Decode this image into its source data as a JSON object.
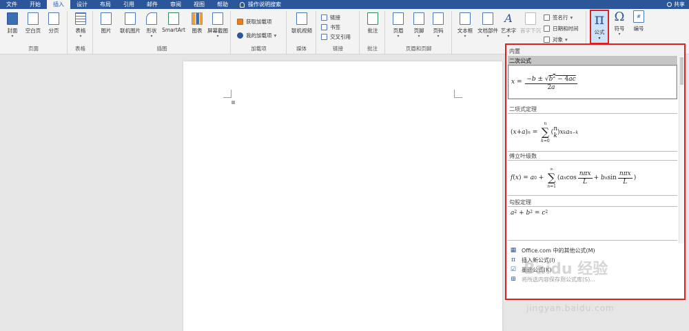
{
  "tabs": [
    "文件",
    "开始",
    "插入",
    "设计",
    "布局",
    "引用",
    "邮件",
    "审阅",
    "视图",
    "帮助"
  ],
  "tell_me": "操作说明搜索",
  "share": "共享",
  "ribbon": {
    "pages": {
      "cover": "封面",
      "blank": "空白页",
      "break": "分页",
      "label": "页面"
    },
    "tables": {
      "table": "表格",
      "label": "表格"
    },
    "illustrations": {
      "picture": "图片",
      "online_picture": "联机图片",
      "shapes": "形状",
      "smartart": "SmartArt",
      "chart": "图表",
      "screenshot": "屏幕截图",
      "label": "插图"
    },
    "addins": {
      "get": "获取加载项",
      "my": "我的加载项",
      "label": "加载项"
    },
    "media": {
      "video": "联机视频",
      "label": "媒体"
    },
    "links": {
      "link": "链接",
      "bookmark": "书签",
      "cross_ref": "交叉引用",
      "label": "链接"
    },
    "comments": {
      "comment": "批注",
      "label": "批注"
    },
    "header_footer": {
      "header": "页眉",
      "footer": "页脚",
      "page_number": "页码",
      "label": "页眉和页脚"
    },
    "text": {
      "textbox": "文本框",
      "quick_parts": "文档部件",
      "wordart": "艺术字",
      "dropcap": "首字下沉",
      "signature": "签名行",
      "datetime": "日期和时间",
      "object": "对象"
    },
    "symbols": {
      "equation": "公式",
      "symbol": "符号",
      "number": "编号"
    }
  },
  "gallery": {
    "header": "内置",
    "items": [
      {
        "title": "二次公式"
      },
      {
        "title": "二项式定理"
      },
      {
        "title": "傅立叶级数"
      },
      {
        "title": "勾股定理"
      }
    ],
    "menu": [
      {
        "icon": "office-icon",
        "label": "Office.com 中的其他公式(M)"
      },
      {
        "icon": "pi-icon",
        "label": "插入新公式(I)"
      },
      {
        "icon": "ink-equation-icon",
        "label": "墨迹公式(K)"
      },
      {
        "icon": "save-selection-icon",
        "label": "将所选内容保存到公式库(S)..."
      }
    ]
  },
  "watermark": {
    "brand": "Baidu 经验",
    "url": "jingyan.baidu.com"
  },
  "colors": {
    "accent": "#2b579a",
    "highlight": "#e02020"
  }
}
